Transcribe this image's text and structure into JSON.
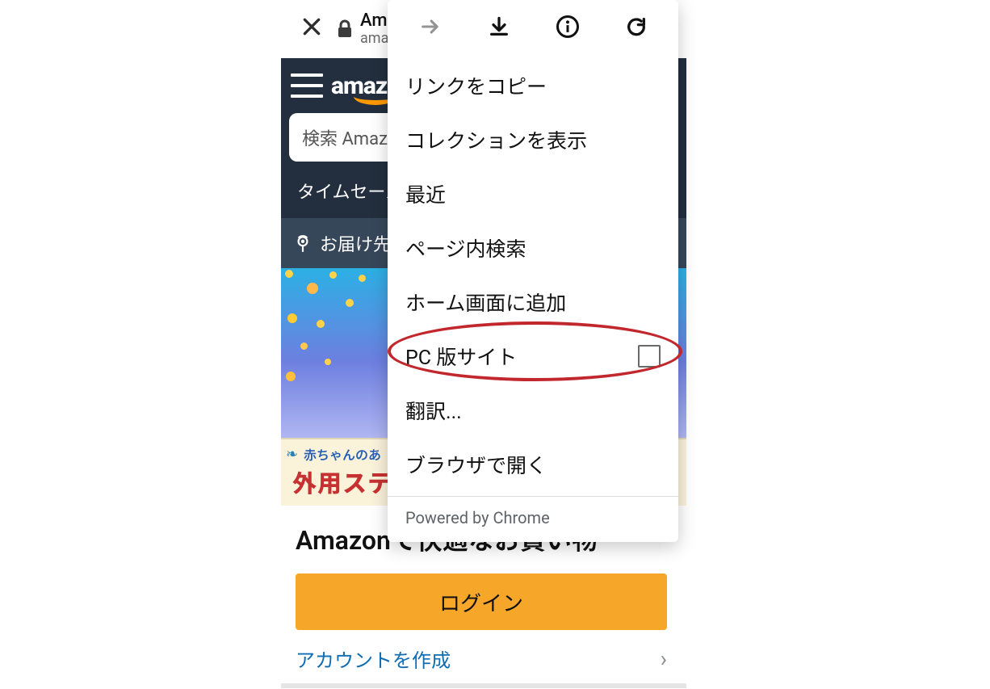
{
  "chrome": {
    "tab_title": "Am",
    "tab_subtitle": "ama"
  },
  "amazon": {
    "logo_text": "amaz",
    "search_placeholder": "検索 Amazo",
    "tabs": {
      "timesale": "タイムセール"
    },
    "deliver": "お届け先の",
    "banner_line1": "赤ちゃんのあ",
    "banner_line2": "外用ステ",
    "section_title": "Amazonで快適なお買い物",
    "login": "ログイン",
    "create_account": "アカウントを作成"
  },
  "menu": {
    "items": {
      "copy_link": "リンクをコピー",
      "show_collections": "コレクションを表示",
      "recent": "最近",
      "find_in_page": "ページ内検索",
      "add_to_home": "ホーム画面に追加",
      "desktop_site": "PC 版サイト",
      "translate": "翻訳...",
      "open_in_browser": "ブラウザで開く"
    },
    "footer": "Powered by Chrome"
  }
}
